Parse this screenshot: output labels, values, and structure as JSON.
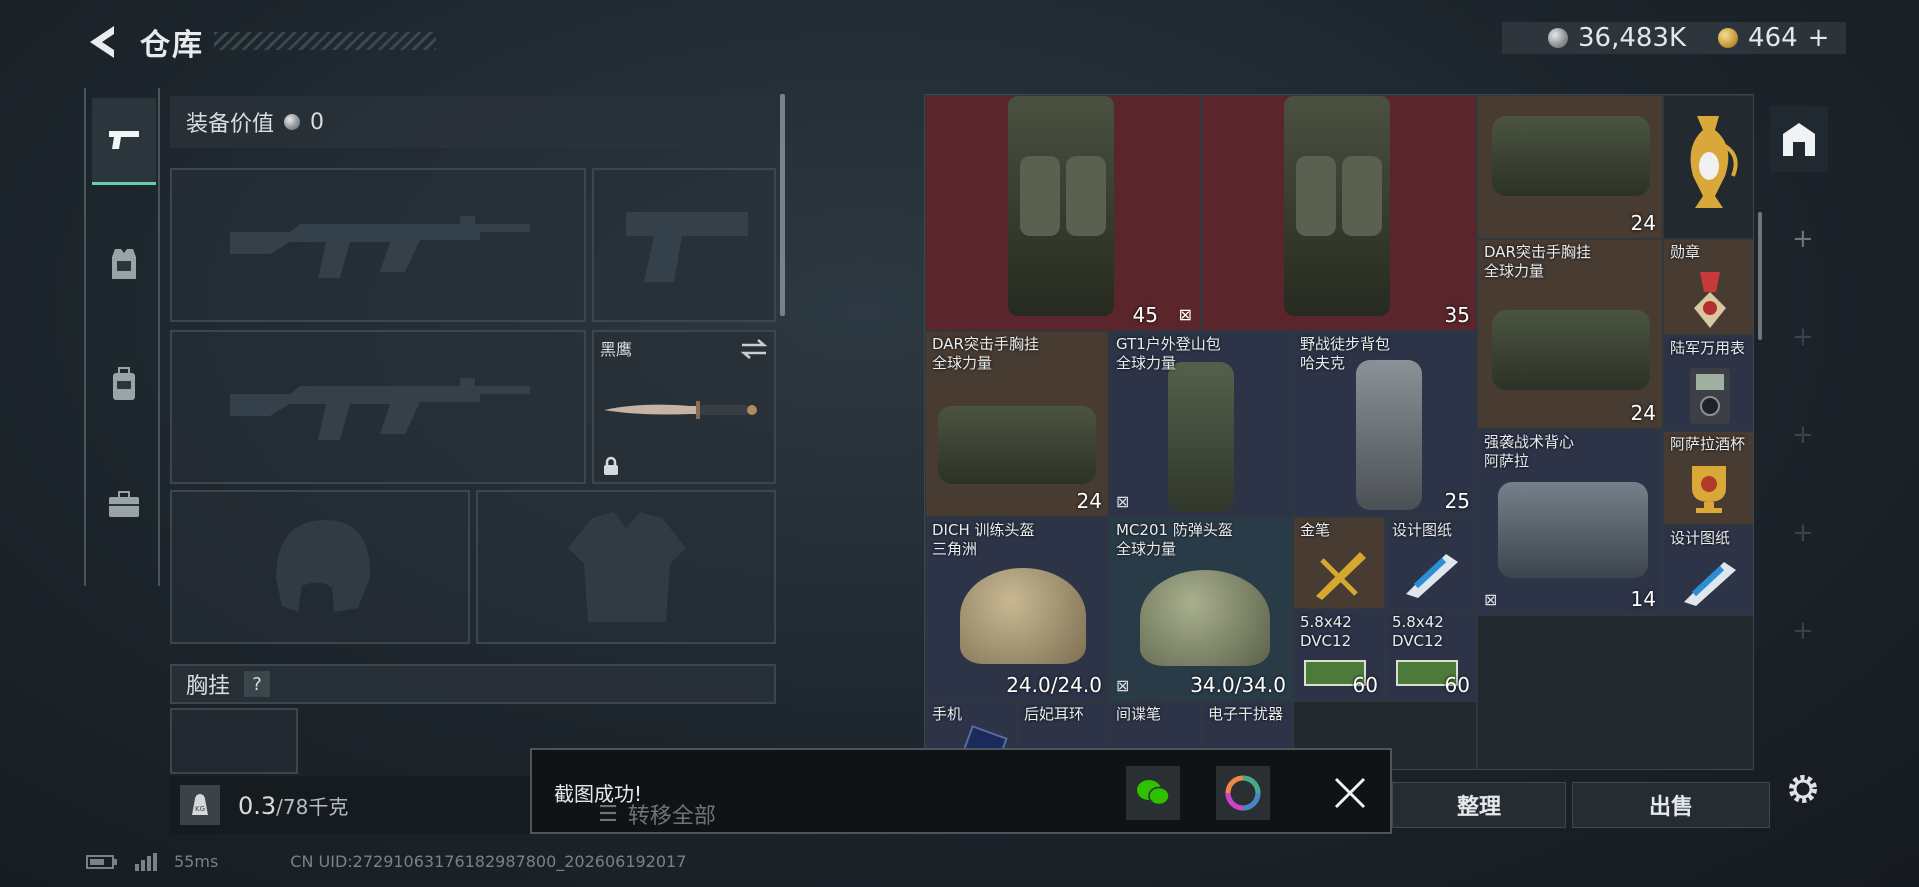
{
  "header": {
    "title": "仓库",
    "silver": "36,483K",
    "gold": "464",
    "gold_plus": "+"
  },
  "equipment": {
    "value_label": "装备价值",
    "value": "0",
    "melee_name": "黑鹰",
    "chest_label": "胸挂",
    "chest_help": "?",
    "weight_current": "0.3",
    "weight_max": "/78千克"
  },
  "inventory": {
    "items": [
      {
        "name": "",
        "count": "45",
        "icon": "helmet-count"
      },
      {
        "name": "",
        "count": "35",
        "icon": "helmet-count"
      },
      {
        "name": "",
        "count": "24",
        "icon": "armor-count"
      },
      {
        "name": "",
        "count": "",
        "icon": ""
      },
      {
        "name": "DAR突击手胸挂\n全球力量",
        "count": "24",
        "icon": "armor-count"
      },
      {
        "name": "勋章",
        "count": "",
        "icon": ""
      },
      {
        "name": "DAR突击手胸挂\n全球力量",
        "count": "24",
        "icon": "armor-count"
      },
      {
        "name": "GT1户外登山包\n全球力量",
        "count": "",
        "icon": ""
      },
      {
        "name": "野战徒步背包\n哈夫克",
        "count": "25",
        "icon": "helmet-count"
      },
      {
        "name": "",
        "count": "24",
        "icon": "helmet-count"
      },
      {
        "name": "陆军万用表",
        "count": "",
        "icon": ""
      },
      {
        "name": "强袭战术背心\n阿萨拉",
        "count": "14",
        "icon": "armor-count"
      },
      {
        "name": "阿萨拉酒杯",
        "count": "",
        "icon": ""
      },
      {
        "name": "DICH 训练头盔\n三角洲",
        "count": "24.0/24.0",
        "icon": ""
      },
      {
        "name": "MC201 防弹头盔\n全球力量",
        "count": "34.0/34.0",
        "icon": ""
      },
      {
        "name": "金笔",
        "count": "",
        "icon": ""
      },
      {
        "name": "设计图纸",
        "count": "",
        "icon": ""
      },
      {
        "name": "设计图纸",
        "count": "",
        "icon": ""
      },
      {
        "name": "5.8x42\nDVC12",
        "count": "60",
        "icon": ""
      },
      {
        "name": "5.8x42\nDVC12",
        "count": "60",
        "icon": ""
      },
      {
        "name": "手机",
        "count": "",
        "icon": ""
      },
      {
        "name": "后妃耳环",
        "count": "",
        "icon": ""
      },
      {
        "name": "间谍笔",
        "count": "",
        "icon": ""
      },
      {
        "name": "电子干扰器",
        "count": "",
        "icon": ""
      }
    ]
  },
  "buttons": {
    "transfer_all": "转移全部",
    "organize": "整理",
    "sell": "出售"
  },
  "toast": {
    "message": "截图成功!"
  },
  "status": {
    "ping": "55ms",
    "uid": "CN UID:272910631761829878​00_202606192017"
  },
  "colors": {
    "accent": "#5fd0b0",
    "rare_red": "#5a262c",
    "epic_purple": "#2e3448",
    "gold_brown": "#473b32"
  }
}
